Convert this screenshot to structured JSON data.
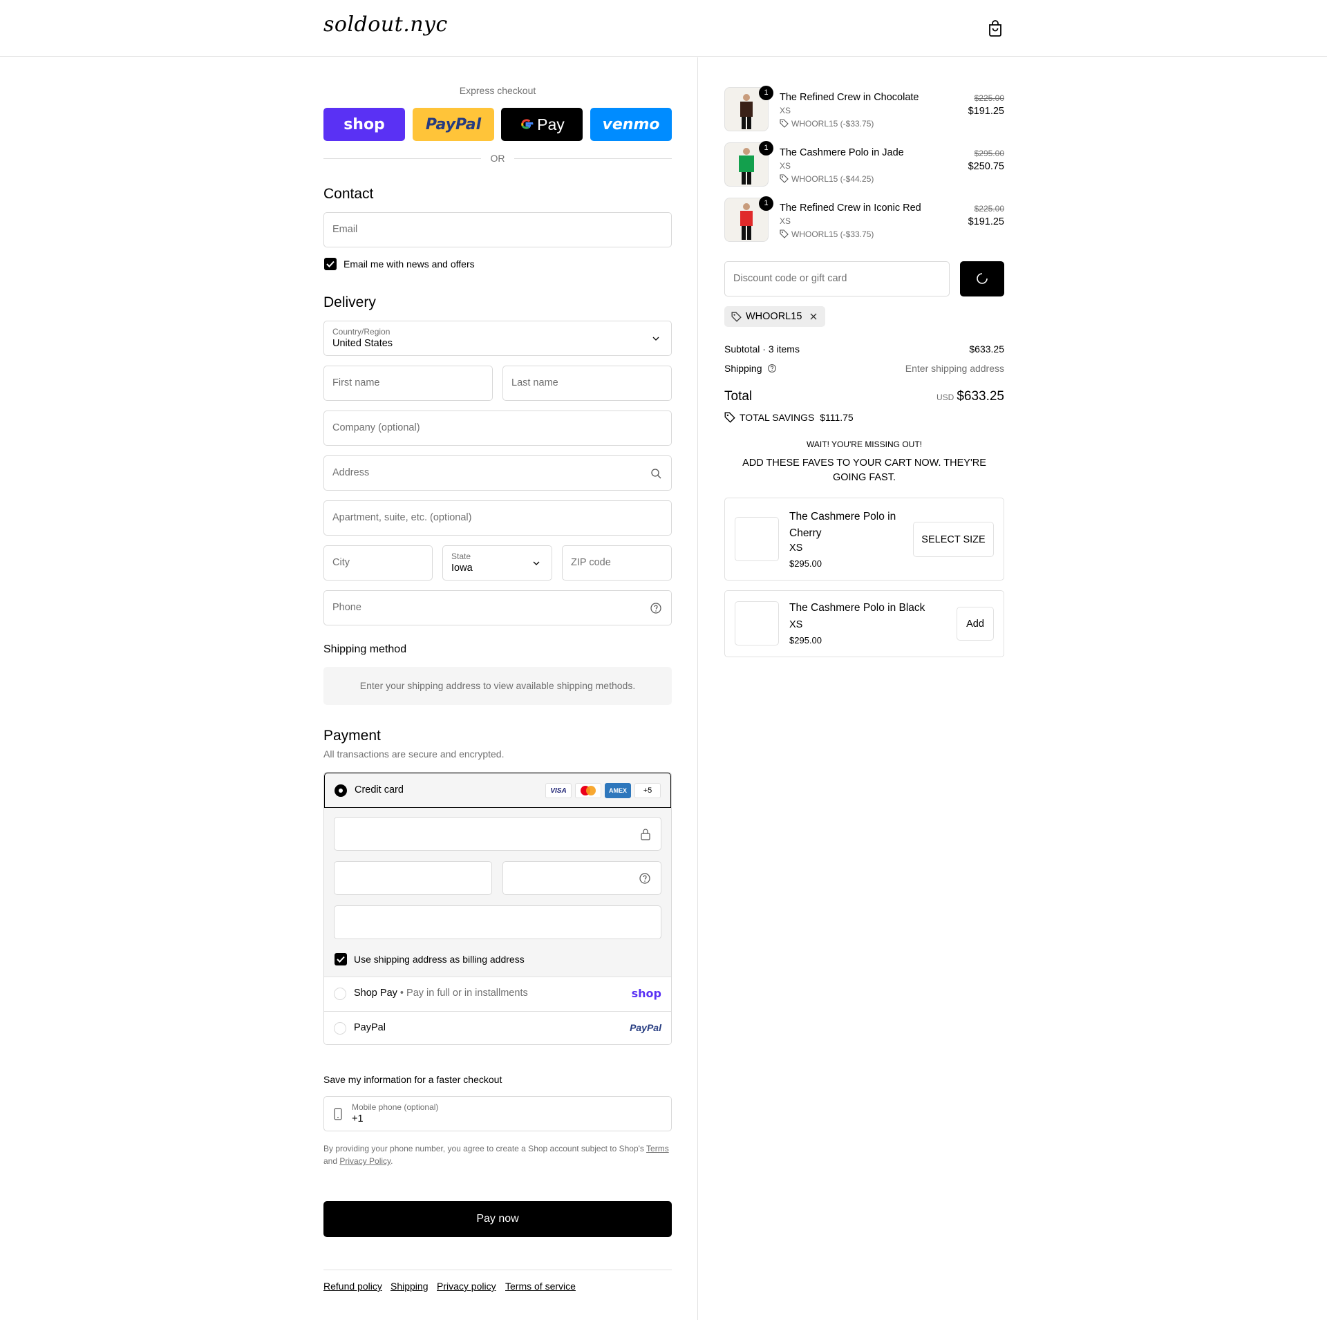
{
  "header": {
    "logo": "soldout.nyc",
    "cart_icon": "shopping-bag-icon"
  },
  "express": {
    "label": "Express checkout",
    "buttons": [
      {
        "label": "shop",
        "bg": "#5a31f4",
        "color": "#ffffff"
      },
      {
        "label": "PayPal",
        "bg": "#ffc439",
        "color": "#253b80"
      },
      {
        "label": "Pay",
        "bg": "#000000",
        "color": "#ffffff"
      },
      {
        "label": "venmo",
        "bg": "#008cff",
        "color": "#ffffff"
      }
    ],
    "or": "OR"
  },
  "contact": {
    "title": "Contact",
    "email_placeholder": "Email",
    "newsletter_label": "Email me with news and offers",
    "newsletter_checked": true
  },
  "delivery": {
    "title": "Delivery",
    "country_label": "Country/Region",
    "country_value": "United States",
    "first_name": "First name",
    "last_name": "Last name",
    "company": "Company (optional)",
    "address": "Address",
    "apartment": "Apartment, suite, etc. (optional)",
    "city": "City",
    "state_label": "State",
    "state_value": "Iowa",
    "zip": "ZIP code",
    "phone": "Phone"
  },
  "shipping_method": {
    "title": "Shipping method",
    "message": "Enter your shipping address to view available shipping methods."
  },
  "payment": {
    "title": "Payment",
    "subtitle": "All transactions are secure and encrypted.",
    "credit_card_label": "Credit card",
    "card_badges": [
      "VISA",
      "MC",
      "AMEX",
      "+5"
    ],
    "billing_label": "Use shipping address as billing address",
    "shop_pay_label": "Shop Pay",
    "shop_pay_sub": "Pay in full or in installments",
    "shop_pay_logo": "shop",
    "paypal_label": "PayPal",
    "paypal_logo": "PayPal"
  },
  "save_info": {
    "title": "Save my information for a faster checkout",
    "phone_label": "Mobile phone (optional)",
    "phone_value": "+1",
    "legal_prefix": "By providing your phone number, you agree to create a Shop account subject to Shop's ",
    "terms_link": "Terms",
    "legal_and": "and ",
    "privacy_link": "Privacy Policy",
    "legal_suffix": "."
  },
  "pay_now": "Pay now",
  "footer_links": [
    "Refund policy",
    "Shipping",
    "Privacy policy",
    "Terms of service"
  ],
  "order": {
    "items": [
      {
        "name": "The Refined Crew in Chocolate",
        "size": "XS",
        "discount": "WHOORL15 (-$33.75)",
        "original": "$225.00",
        "price": "$191.25",
        "qty": "1",
        "color": "#3a2118"
      },
      {
        "name": "The Cashmere Polo in Jade",
        "size": "XS",
        "discount": "WHOORL15 (-$44.25)",
        "original": "$295.00",
        "price": "$250.75",
        "qty": "1",
        "color": "#13a04d"
      },
      {
        "name": "The Refined Crew in Iconic Red",
        "size": "XS",
        "discount": "WHOORL15 (-$33.75)",
        "original": "$225.00",
        "price": "$191.25",
        "qty": "1",
        "color": "#e02a2a"
      }
    ],
    "discount_placeholder": "Discount code or gift card",
    "applied_code": "WHOORL15",
    "subtotal_label": "Subtotal · 3 items",
    "subtotal_value": "$633.25",
    "shipping_label": "Shipping",
    "shipping_value": "Enter shipping address",
    "total_label": "Total",
    "total_currency": "USD",
    "total_value": "$633.25",
    "savings_label": "TOTAL SAVINGS",
    "savings_value": "$111.75"
  },
  "upsell": {
    "heading": "WAIT! YOU'RE MISSING OUT!",
    "subheading": "ADD THESE FAVES TO YOUR CART NOW. THEY'RE GOING FAST.",
    "items": [
      {
        "name": "The Cashmere Polo in Cherry",
        "size": "XS",
        "price": "$295.00",
        "button": "SELECT SIZE"
      },
      {
        "name": "The Cashmere Polo in Black",
        "size": "XS",
        "price": "$295.00",
        "button": "Add"
      }
    ]
  }
}
